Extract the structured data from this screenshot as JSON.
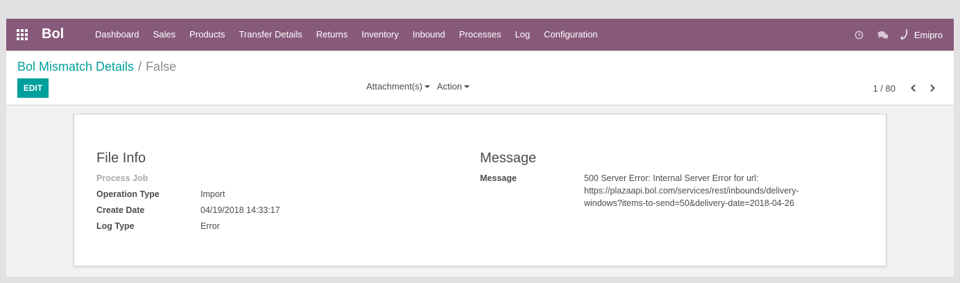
{
  "navbar": {
    "brand": "Bol",
    "menu": [
      "Dashboard",
      "Sales",
      "Products",
      "Transfer Details",
      "Returns",
      "Inventory",
      "Inbound",
      "Processes",
      "Log",
      "Configuration"
    ],
    "user_name": "Emipro",
    "icons": [
      "apps-grid-icon",
      "clock-icon",
      "chat-icon",
      "user-logo-icon"
    ],
    "color": "#875a7b"
  },
  "breadcrumb": {
    "parent": "Bol Mismatch Details",
    "separator": "/",
    "current": "False"
  },
  "buttons": {
    "edit": "EDIT"
  },
  "sidebar_actions": {
    "attachments": "Attachment(s)",
    "action": "Action"
  },
  "pager": {
    "value": "1 / 80"
  },
  "file_info": {
    "title": "File Info",
    "process_job_label": "Process Job",
    "operation_type_label": "Operation Type",
    "operation_type_value": "Import",
    "create_date_label": "Create Date",
    "create_date_value": "04/19/2018 14:33:17",
    "log_type_label": "Log Type",
    "log_type_value": "Error"
  },
  "message": {
    "title": "Message",
    "label": "Message",
    "line1": "500 Server Error: Internal Server Error for url:",
    "line2": "https://plazaapi.bol.com/services/rest/inbounds/delivery-",
    "line3": "windows?items-to-send=50&delivery-date=2018-04-26"
  },
  "colors": {
    "accent": "#00a09d",
    "navbar": "#875a7b"
  }
}
